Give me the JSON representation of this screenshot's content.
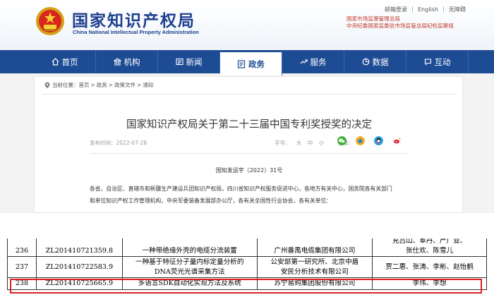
{
  "header": {
    "title_cn": "国家知识产权局",
    "title_en": "China National Intellectual Property Administration",
    "top_links": [
      "邮箱登录",
      "English",
      "无障碍"
    ],
    "related": [
      "国家市场监督管理总局",
      "中央纪委国家监委驻市场监管总局纪检监察组"
    ]
  },
  "nav": {
    "items": [
      {
        "label": "首页",
        "icon": "home-icon"
      },
      {
        "label": "机构",
        "icon": "building-icon"
      },
      {
        "label": "新闻",
        "icon": "news-icon"
      },
      {
        "label": "政务",
        "icon": "government-icon",
        "active": true
      },
      {
        "label": "服务",
        "icon": "service-icon"
      },
      {
        "label": "数据",
        "icon": "data-icon"
      },
      {
        "label": "互动",
        "icon": "interact-icon"
      }
    ]
  },
  "breadcrumb": {
    "prefix": "当前位置：",
    "items": [
      "首页",
      "政务",
      "政策文件",
      "通知"
    ],
    "separator": ">"
  },
  "article": {
    "title": "国家知识产权局关于第二十三届中国专利奖授奖的决定",
    "date": "发布时间：2022-07-26",
    "font_size_label": "字号：",
    "font_sizes": [
      "大",
      "中",
      "小"
    ],
    "share_label": "分享:",
    "share_icons": [
      "wechat-icon",
      "qzone-icon",
      "qq-icon",
      "weibo-icon"
    ],
    "doc_number": "国知发运字〔2022〕31号",
    "body_lines": [
      "各省、自治区、直辖市和新疆生产建设兵团知识产权局，四川省知识产权服务促进中心，各地方有关中心，国务院各有关部门",
      "和单位知识产权工作管理机构，中央军委装备发展部办公厅，各有关全国性行业协会，各有关单位："
    ]
  },
  "table": {
    "rows": [
      {
        "no": "236",
        "id": "ZL201410721359.8",
        "title": "一种带绝缘外壳的电缆分流装置",
        "org": "广州番禺电缆集团有限公司",
        "inventors": [
          "张仕欢、陈雪儿"
        ]
      },
      {
        "no": "237",
        "id": "ZL201410722583.9",
        "title": "一种基于特征分子量内标定量分析的DNA荧光光谱采集方法",
        "org": "公安部第一研究所、北京中盾安民分析技术有限公司",
        "inventors": [
          "贾二惠、张涛、李彬、赵怡鹤"
        ]
      },
      {
        "no": "238",
        "id": "ZL201410725665.9",
        "title": "多语言SDK自动化实现方法及系统",
        "org": "苏宁易购集团股份有限公司",
        "inventors": [
          "李伟、李想"
        ]
      }
    ],
    "partial_top_inventor": "充吕山、阜丹、严广亚、",
    "title_row2_prefix": "一种基于特征分子量内标定量分析的",
    "title_row2_suffix": "DNA荧光光谱采集方法",
    "org_row2_line1": "公安部第一研究所、北京中盾",
    "org_row2_line2": "安民分析技术有限公司",
    "highlight_color": "#e02020"
  },
  "colors": {
    "nav_bg": "#1e4c94",
    "title_blue": "#1d3f8f",
    "related_red": "#c0392b"
  }
}
